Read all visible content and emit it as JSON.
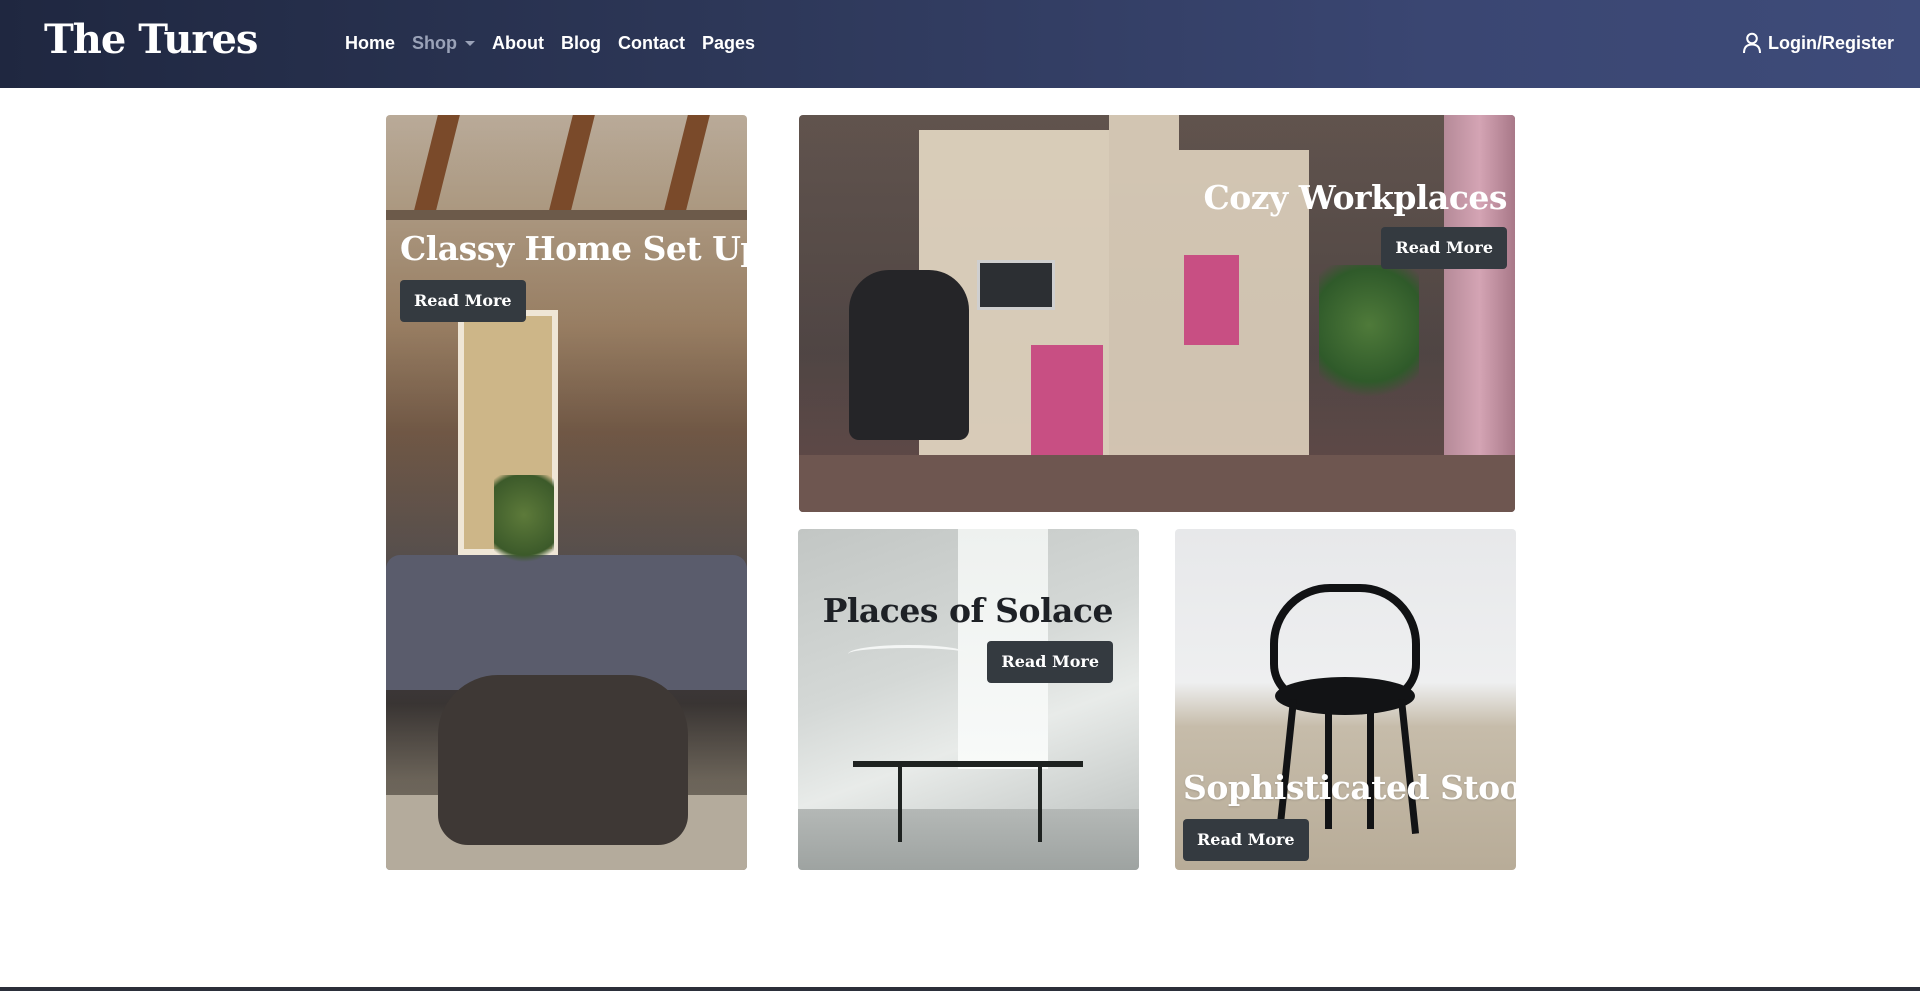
{
  "brand": {
    "name": "The Tures"
  },
  "nav": {
    "items": [
      {
        "label": "Home"
      },
      {
        "label": "Shop"
      },
      {
        "label": "About"
      },
      {
        "label": "Blog"
      },
      {
        "label": "Contact"
      },
      {
        "label": "Pages"
      }
    ],
    "login_label": "Login/Register",
    "login_icon": "user-icon",
    "shop_dropdown_icon": "caret-down-icon"
  },
  "colors": {
    "nav_gradient_start": "#1f2740",
    "nav_gradient_end": "#3e4b79",
    "button_bg": "#343a40",
    "muted_nav_link": "#9aa2b8"
  },
  "cards": [
    {
      "title": "Classy Home Set Ups",
      "button": "Read More"
    },
    {
      "title": "Cozy Workplaces",
      "button": "Read More"
    },
    {
      "title": "Places of Solace",
      "button": "Read More"
    },
    {
      "title": "Sophisticated Stools",
      "button": "Read More"
    }
  ]
}
